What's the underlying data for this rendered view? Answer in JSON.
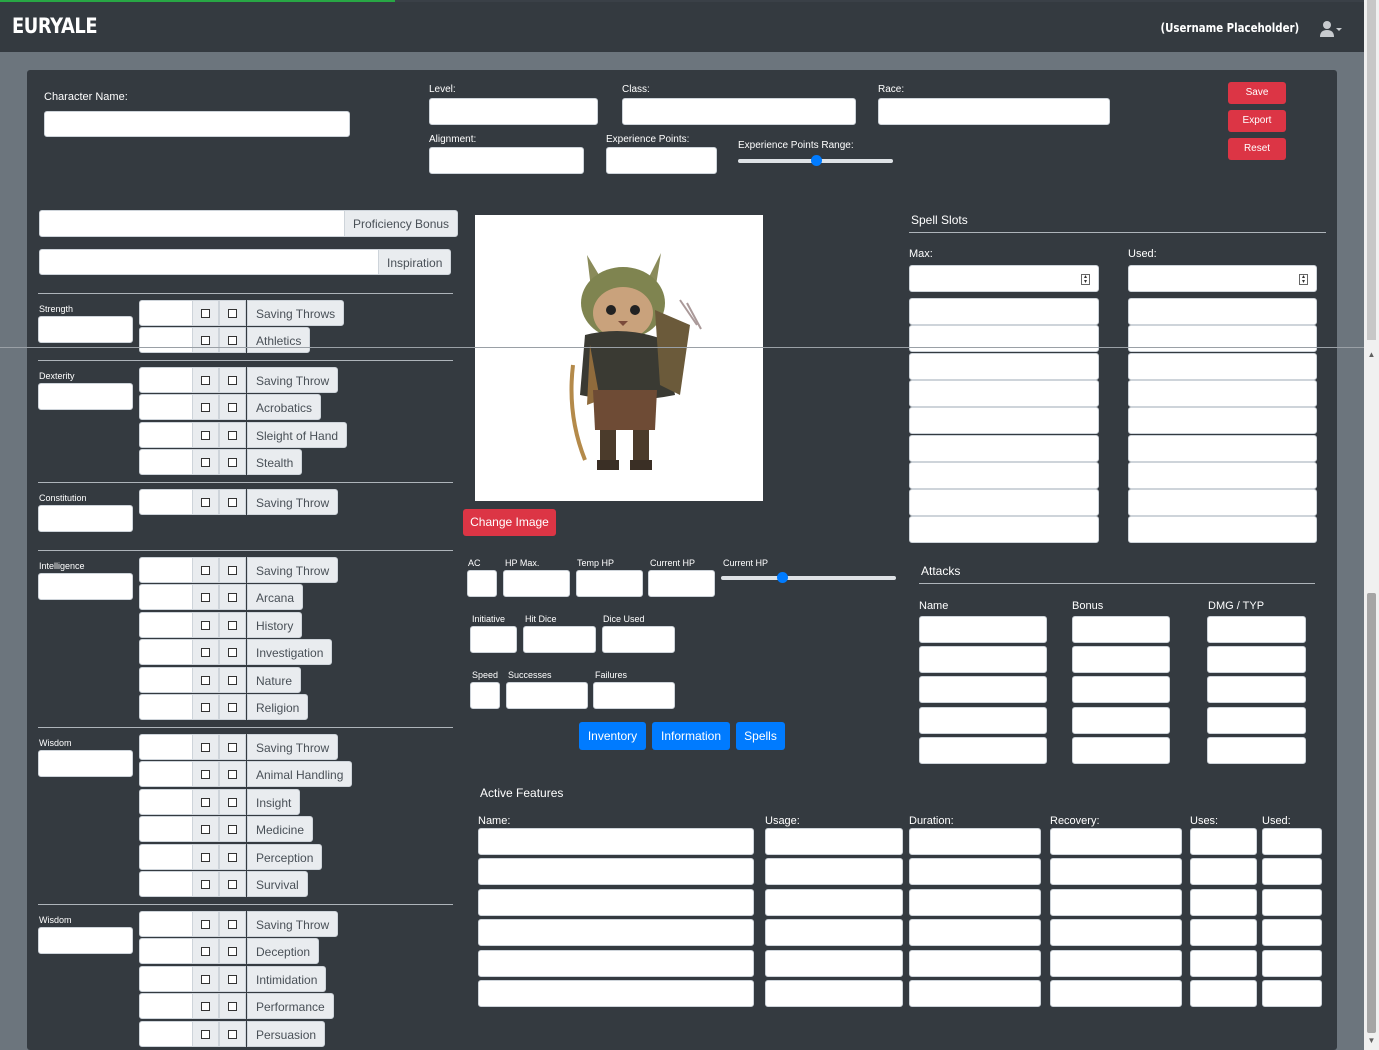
{
  "app": {
    "brand": "EURYALE",
    "username": "(Username Placeholder)"
  },
  "header": {
    "character_name_label": "Character Name:",
    "level_label": "Level:",
    "class_label": "Class:",
    "race_label": "Race:",
    "alignment_label": "Alignment:",
    "xp_label": "Experience Points:",
    "xp_range_label": "Experience Points Range:",
    "xp_range_value": 0.5,
    "buttons": {
      "save": "Save",
      "export": "Export",
      "reset": "Reset"
    }
  },
  "left": {
    "proficiency_bonus": "Proficiency Bonus",
    "inspiration": "Inspiration",
    "abilities": [
      {
        "name": "Strength",
        "skills": [
          "Saving Throws",
          "Athletics"
        ]
      },
      {
        "name": "Dexterity",
        "skills": [
          "Saving Throw",
          "Acrobatics",
          "Sleight of Hand",
          "Stealth"
        ]
      },
      {
        "name": "Constitution",
        "skills": [
          "Saving Throw"
        ]
      },
      {
        "name": "Intelligence",
        "skills": [
          "Saving Throw",
          "Arcana",
          "History",
          "Investigation",
          "Nature",
          "Religion"
        ]
      },
      {
        "name": "Wisdom",
        "skills": [
          "Saving Throw",
          "Animal Handling",
          "Insight",
          "Medicine",
          "Perception",
          "Survival"
        ]
      },
      {
        "name": "Wisdom",
        "skills": [
          "Saving Throw",
          "Deception",
          "Intimidation",
          "Performance",
          "Persuasion"
        ]
      }
    ]
  },
  "center": {
    "change_image": "Change Image",
    "ac": "AC",
    "hp_max": "HP Max.",
    "temp_hp": "Temp HP",
    "current_hp": "Current HP",
    "current_hp_slider_label": "Current HP",
    "current_hp_slider_value": 0.35,
    "initiative": "Initiative",
    "hit_dice": "Hit Dice",
    "dice_used": "Dice Used",
    "speed": "Speed",
    "successes": "Successes",
    "failures": "Failures",
    "tabs": {
      "inventory": "Inventory",
      "information": "Information",
      "spells": "Spells"
    }
  },
  "spell_slots": {
    "title": "Spell Slots",
    "max_label": "Max:",
    "used_label": "Used:"
  },
  "attacks": {
    "title": "Attacks",
    "name": "Name",
    "bonus": "Bonus",
    "dmg": "DMG / TYP"
  },
  "features": {
    "title": "Active Features",
    "name": "Name:",
    "usage": "Usage:",
    "duration": "Duration:",
    "recovery": "Recovery:",
    "uses": "Uses:",
    "used": "Used:"
  },
  "colors": {
    "danger": "#dc3545",
    "primary": "#007bff",
    "panel": "#343a40",
    "page": "#6c757d"
  }
}
